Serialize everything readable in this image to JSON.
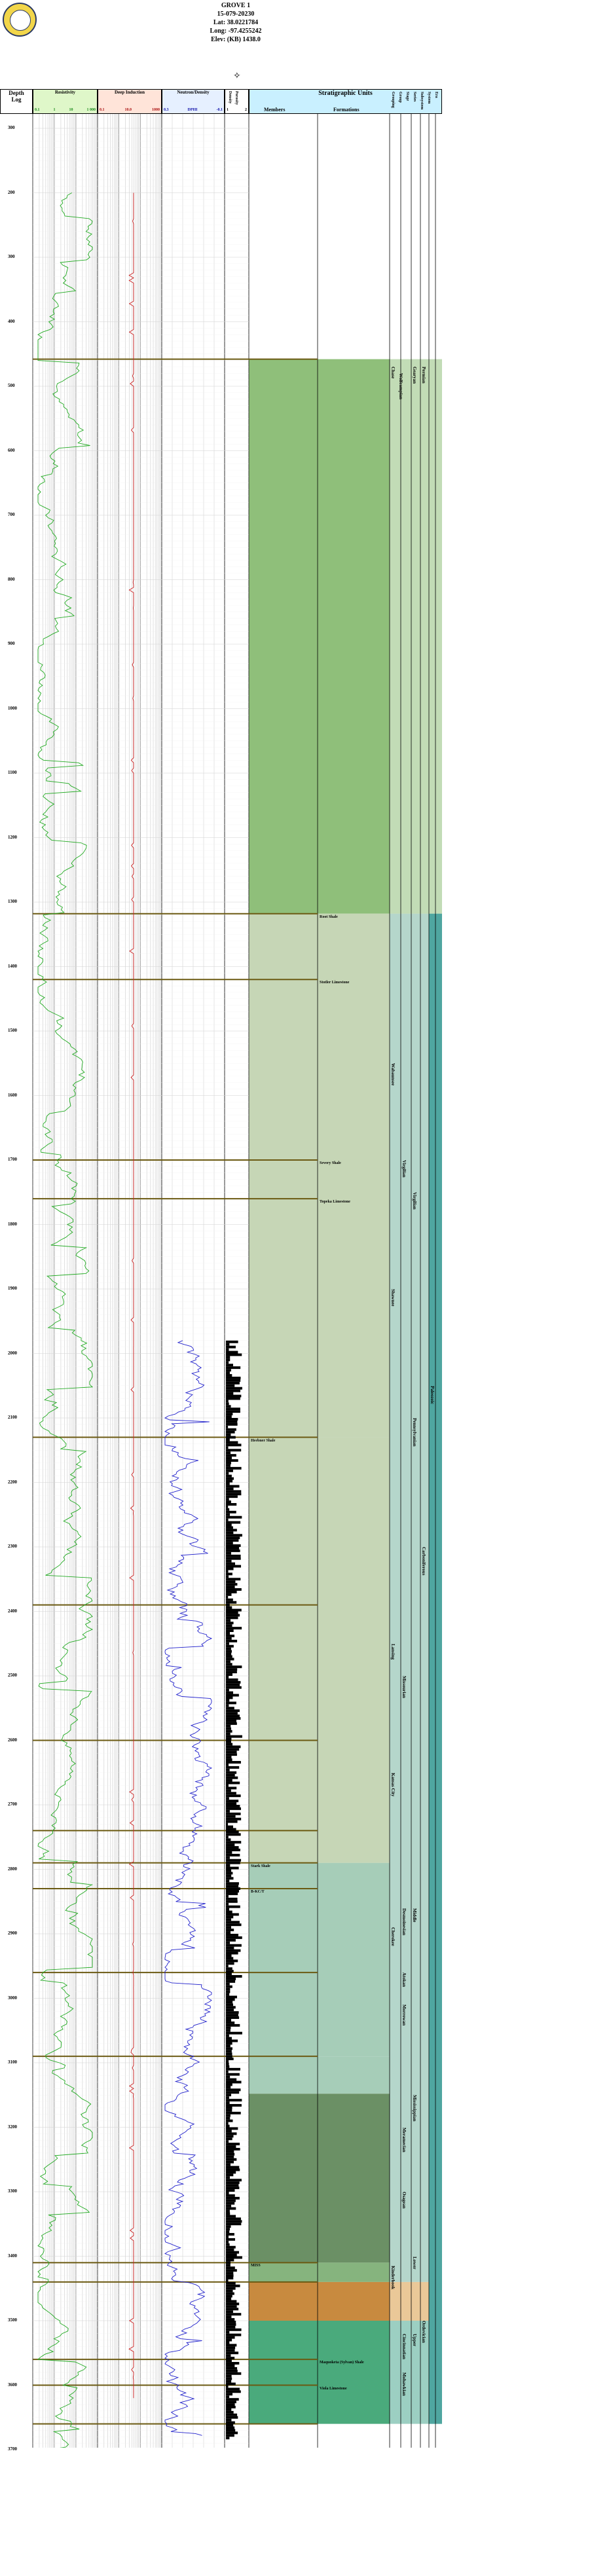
{
  "well": {
    "name": "GROVE 1",
    "api": "15-079-20230",
    "lat": "Lat: 38.0221784",
    "long": "Long: -97.4255242",
    "elev": "Elev: (KB) 1438.0"
  },
  "header": {
    "depth_label": "Depth",
    "log_label": "Log",
    "resistivity": {
      "title": "Resistivity",
      "scale_left": "0.1",
      "scale_mid1": "1",
      "scale_mid2": "10",
      "scale_right": "1 000"
    },
    "induction": {
      "title": "Deep Induction",
      "scale_left": "0.1",
      "scale_mid": "10.0",
      "scale_right": "1000"
    },
    "neutron": {
      "title": "Neutron/Density",
      "scale_left": "0.3",
      "scale_mid": "DPHI",
      "scale_right": "-0.1"
    },
    "density_col": {
      "title": "Density",
      "sub": "Porosity",
      "scale_left": "1",
      "scale_right": "2"
    },
    "strat": {
      "title": "Stratigraphic Units",
      "members": "Members",
      "formations": "Formations"
    },
    "vertical_cols": [
      "Grouping",
      "Group",
      "Stage",
      "Series",
      "Subsystem",
      "System",
      "Era"
    ]
  },
  "depth_ticks": [
    "300",
    "200",
    "300",
    "400",
    "500",
    "600",
    "700",
    "800",
    "900",
    "1000",
    "1100",
    "1200",
    "1300",
    "1400",
    "1500",
    "1600",
    "1700",
    "1800",
    "1900",
    "2000",
    "2100",
    "2200",
    "2300",
    "2400",
    "2500",
    "2600",
    "2700",
    "2800",
    "2900",
    "3000",
    "3100",
    "3200",
    "3300",
    "3400",
    "3500",
    "3600",
    "3700"
  ],
  "members": [
    "Root Shale",
    "Stotler Limestone",
    "Severy Shale",
    "Topeka Limestone",
    "Heebner Shale",
    "Stark Shale",
    "B-KC/T",
    "MISS",
    "Maquoketa (Sylvan) Shale",
    "Viola Limestone"
  ],
  "group_labels": [
    "Chase",
    "Wolfcampian",
    "Wabaunsee",
    "Shawnee",
    "Lansing",
    "Kansas City",
    "Cherokee",
    "Kinderhook"
  ],
  "stage_labels": [
    "Virgilian",
    "Missourian",
    "Desmoinesian",
    "Atokan",
    "Morrowan",
    "Meramecian",
    "Osagean",
    "Cincinnatian",
    "Mohawkian"
  ],
  "series_labels": [
    "Gearyan",
    "Virgilian",
    "Pennsylvanian",
    "Middle",
    "Lower",
    "Upper",
    "Mississippian"
  ],
  "system_labels": [
    "Permian",
    "Carboniferous",
    "Ordovician"
  ],
  "era_labels": [
    "Paleozoic"
  ],
  "colors": {
    "permian": "#8fbf7a",
    "penn_upper": "#c6d6b6",
    "penn_middle": "#a6cdb8",
    "miss": "#6b9065",
    "ord": "#4aaa7c",
    "cambro": "#c88a3f",
    "resistivity_curve": "#22aa22",
    "induction_curve": "#cc2222",
    "neutron_curve": "#2222cc",
    "marker_line": "#6b5a12"
  }
}
